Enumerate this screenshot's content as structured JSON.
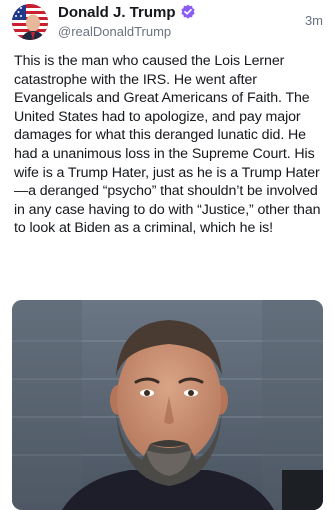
{
  "post": {
    "author": {
      "display_name": "Donald J. Trump",
      "handle": "@realDonaldTrump",
      "verified": true,
      "avatar_icon": "flag-portrait-avatar",
      "verified_icon": "verified-badge-icon",
      "verified_color": "#8b5cf6"
    },
    "timestamp": "3m",
    "text": "This is the man who caused the Lois Lerner catastrophe with the IRS. He went after Evangelicals and Great Americans of Faith. The United States had to apologize, and pay major damages for what this deranged lunatic did. He had a unanimous loss in the Supreme Court. His wife is a Trump Hater, just as he is a Trump Hater—a deranged “psycho” that shouldn’t be involved in any case having to do with “Justice,” other than to look at Biden as a criminal, which he is!",
    "media": {
      "type": "photo"
    }
  }
}
